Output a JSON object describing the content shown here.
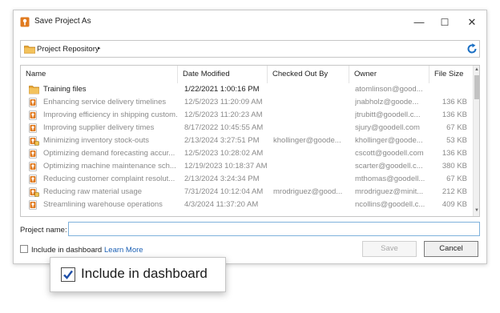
{
  "window": {
    "title": "Save Project As",
    "icon": "project-app-icon",
    "minimize_glyph": "—",
    "maximize_glyph": "☐",
    "close_glyph": "✕"
  },
  "path_bar": {
    "label": "Project Repository",
    "arrow": "▸",
    "refresh_icon": "refresh-icon"
  },
  "columns": {
    "name": "Name",
    "date": "Date Modified",
    "checked_out_by": "Checked Out By",
    "owner": "Owner",
    "size": "File Size"
  },
  "sort_indicator": "▲",
  "rows": [
    {
      "type": "folder",
      "name": "Training files",
      "date": "1/22/2021 1:00:16 PM",
      "checked_out_by": "",
      "owner": "atomlinson@good...",
      "size": ""
    },
    {
      "type": "project",
      "name": "Enhancing service delivery timelines",
      "date": "12/5/2023 11:20:09 AM",
      "checked_out_by": "",
      "owner": "jnabholz@goode...",
      "size": "136 KB"
    },
    {
      "type": "project",
      "name": "Improving efficiency in shipping custom...",
      "date": "12/5/2023 11:20:23 AM",
      "checked_out_by": "",
      "owner": "jtrubitt@goodell.c...",
      "size": "136 KB"
    },
    {
      "type": "project",
      "name": "Improving supplier delivery times",
      "date": "8/17/2022 10:45:55 AM",
      "checked_out_by": "",
      "owner": "sjury@goodell.com",
      "size": "67 KB"
    },
    {
      "type": "project-locked",
      "name": "Minimizing inventory stock-outs",
      "date": "2/13/2024 3:27:51 PM",
      "checked_out_by": "khollinger@goode...",
      "owner": "khollinger@goode...",
      "size": "53 KB"
    },
    {
      "type": "project",
      "name": "Optimizing demand forecasting accur...",
      "date": "12/5/2023 10:28:02 AM",
      "checked_out_by": "",
      "owner": "cscott@goodell.com",
      "size": "136 KB"
    },
    {
      "type": "project",
      "name": "Optimizing machine maintenance sch...",
      "date": "12/19/2023 10:18:37 AM",
      "checked_out_by": "",
      "owner": "scarter@goodell.c...",
      "size": "380 KB"
    },
    {
      "type": "project",
      "name": "Reducing customer complaint resolut...",
      "date": "2/13/2024 3:24:34 PM",
      "checked_out_by": "",
      "owner": "mthomas@goodell...",
      "size": "67 KB"
    },
    {
      "type": "project-locked",
      "name": "Reducing raw material usage",
      "date": "7/31/2024 10:12:04 AM",
      "checked_out_by": "mrodriguez@good...",
      "owner": "mrodriguez@minit...",
      "size": "212 KB"
    },
    {
      "type": "project",
      "name": "Streamlining warehouse operations",
      "date": "4/3/2024 11:37:20 AM",
      "checked_out_by": "",
      "owner": "ncollins@goodell.c...",
      "size": "409 KB"
    }
  ],
  "project_name": {
    "label": "Project name:",
    "value": "",
    "placeholder": ""
  },
  "include_dashboard": {
    "label": "Include in dashboard",
    "checked": false
  },
  "learn_more": "Learn More",
  "buttons": {
    "save": "Save",
    "cancel": "Cancel"
  },
  "callout": {
    "label": "Include in dashboard",
    "checked": true
  },
  "colors": {
    "accent": "#1a5fb4",
    "project_icon": "#e07a1f",
    "folder_icon": "#e8a838",
    "dim_text": "#8a8a8a",
    "check_mark": "#1f4fa8"
  }
}
